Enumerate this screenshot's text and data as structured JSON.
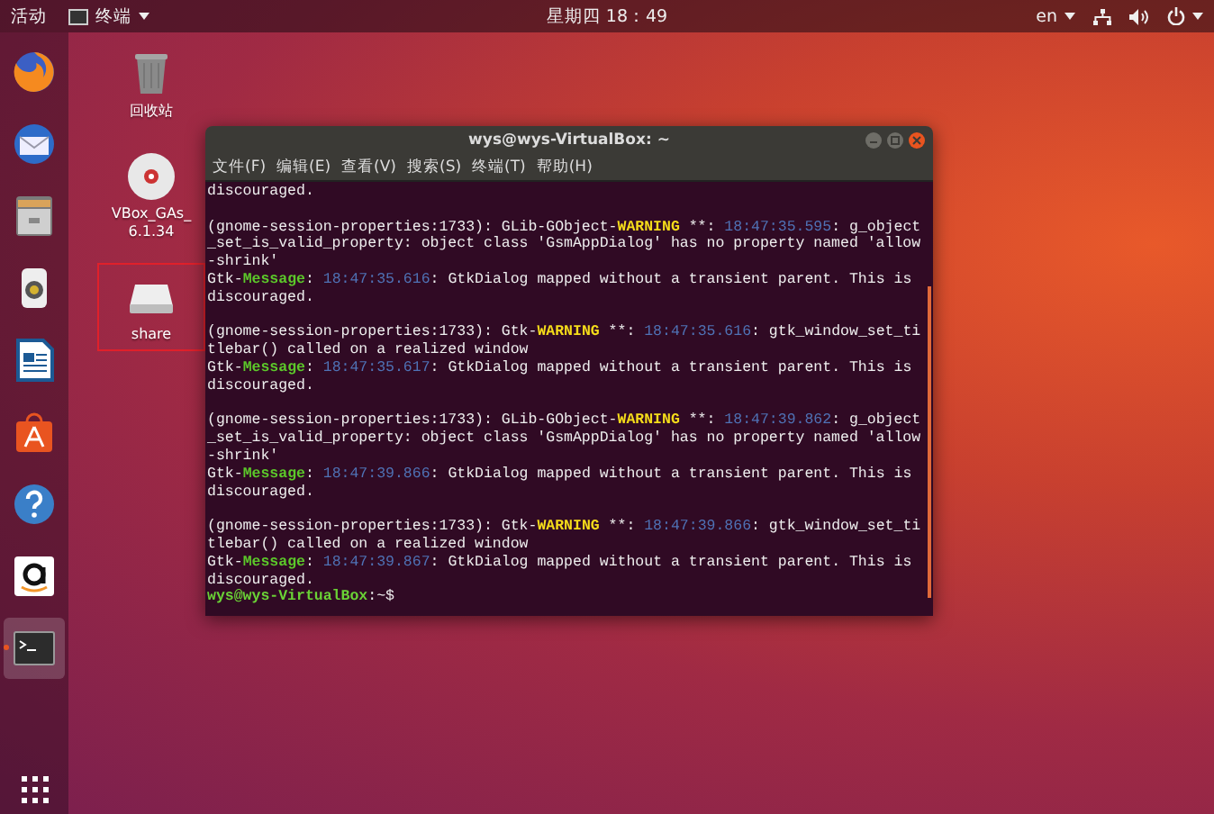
{
  "top_bar": {
    "activities": "活动",
    "app_menu": "终端",
    "clock": "星期四 18：49",
    "input_method": "en"
  },
  "dock": {
    "items": [
      {
        "kind": "firefox",
        "active": false
      },
      {
        "kind": "mail",
        "active": false
      },
      {
        "kind": "files",
        "active": false
      },
      {
        "kind": "music",
        "active": false
      },
      {
        "kind": "writer",
        "active": false
      },
      {
        "kind": "software",
        "active": false
      },
      {
        "kind": "help",
        "active": false
      },
      {
        "kind": "amazon",
        "active": false
      },
      {
        "kind": "terminal",
        "active": true
      }
    ]
  },
  "desktop": {
    "icons": [
      {
        "kind": "trash",
        "label": "回收站",
        "highlighted": false
      },
      {
        "kind": "disc",
        "label": "VBox_GAs_6.1.34",
        "highlighted": false
      },
      {
        "kind": "drive",
        "label": "share",
        "highlighted": true
      }
    ]
  },
  "terminal": {
    "title": "wys@wys-VirtualBox: ~",
    "menu": [
      "文件(F)",
      "编辑(E)",
      "查看(V)",
      "搜索(S)",
      "终端(T)",
      "帮助(H)"
    ],
    "lines": [
      {
        "kind": "text",
        "segments": [
          {
            "kind": "plain",
            "text": "discouraged."
          }
        ]
      },
      {
        "kind": "blank"
      },
      {
        "kind": "text",
        "segments": [
          {
            "kind": "plain",
            "text": "(gnome-session-properties:1733): GLib-GObject-"
          },
          {
            "kind": "warning",
            "text": "WARNING"
          },
          {
            "kind": "plain",
            "text": " **: "
          },
          {
            "kind": "time",
            "text": "18:47:35.595"
          },
          {
            "kind": "plain",
            "text": ": g_object"
          }
        ]
      },
      {
        "kind": "text",
        "segments": [
          {
            "kind": "plain",
            "text": "_set_is_valid_property: object class 'GsmAppDialog' has no property named 'allow"
          }
        ]
      },
      {
        "kind": "text",
        "segments": [
          {
            "kind": "plain",
            "text": "-shrink'"
          }
        ]
      },
      {
        "kind": "text",
        "segments": [
          {
            "kind": "plain",
            "text": "Gtk-"
          },
          {
            "kind": "message",
            "text": "Message"
          },
          {
            "kind": "plain",
            "text": ": "
          },
          {
            "kind": "time",
            "text": "18:47:35.616"
          },
          {
            "kind": "plain",
            "text": ": GtkDialog mapped without a transient parent. This is"
          }
        ]
      },
      {
        "kind": "text",
        "segments": [
          {
            "kind": "plain",
            "text": "discouraged."
          }
        ]
      },
      {
        "kind": "blank"
      },
      {
        "kind": "text",
        "segments": [
          {
            "kind": "plain",
            "text": "(gnome-session-properties:1733): Gtk-"
          },
          {
            "kind": "warning",
            "text": "WARNING"
          },
          {
            "kind": "plain",
            "text": " **: "
          },
          {
            "kind": "time",
            "text": "18:47:35.616"
          },
          {
            "kind": "plain",
            "text": ": gtk_window_set_ti"
          }
        ]
      },
      {
        "kind": "text",
        "segments": [
          {
            "kind": "plain",
            "text": "tlebar() called on a realized window"
          }
        ]
      },
      {
        "kind": "text",
        "segments": [
          {
            "kind": "plain",
            "text": "Gtk-"
          },
          {
            "kind": "message",
            "text": "Message"
          },
          {
            "kind": "plain",
            "text": ": "
          },
          {
            "kind": "time",
            "text": "18:47:35.617"
          },
          {
            "kind": "plain",
            "text": ": GtkDialog mapped without a transient parent. This is"
          }
        ]
      },
      {
        "kind": "text",
        "segments": [
          {
            "kind": "plain",
            "text": "discouraged."
          }
        ]
      },
      {
        "kind": "blank"
      },
      {
        "kind": "text",
        "segments": [
          {
            "kind": "plain",
            "text": "(gnome-session-properties:1733): GLib-GObject-"
          },
          {
            "kind": "warning",
            "text": "WARNING"
          },
          {
            "kind": "plain",
            "text": " **: "
          },
          {
            "kind": "time",
            "text": "18:47:39.862"
          },
          {
            "kind": "plain",
            "text": ": g_object"
          }
        ]
      },
      {
        "kind": "text",
        "segments": [
          {
            "kind": "plain",
            "text": "_set_is_valid_property: object class 'GsmAppDialog' has no property named 'allow"
          }
        ]
      },
      {
        "kind": "text",
        "segments": [
          {
            "kind": "plain",
            "text": "-shrink'"
          }
        ]
      },
      {
        "kind": "text",
        "segments": [
          {
            "kind": "plain",
            "text": "Gtk-"
          },
          {
            "kind": "message",
            "text": "Message"
          },
          {
            "kind": "plain",
            "text": ": "
          },
          {
            "kind": "time",
            "text": "18:47:39.866"
          },
          {
            "kind": "plain",
            "text": ": GtkDialog mapped without a transient parent. This is"
          }
        ]
      },
      {
        "kind": "text",
        "segments": [
          {
            "kind": "plain",
            "text": "discouraged."
          }
        ]
      },
      {
        "kind": "blank"
      },
      {
        "kind": "text",
        "segments": [
          {
            "kind": "plain",
            "text": "(gnome-session-properties:1733): Gtk-"
          },
          {
            "kind": "warning",
            "text": "WARNING"
          },
          {
            "kind": "plain",
            "text": " **: "
          },
          {
            "kind": "time",
            "text": "18:47:39.866"
          },
          {
            "kind": "plain",
            "text": ": gtk_window_set_ti"
          }
        ]
      },
      {
        "kind": "text",
        "segments": [
          {
            "kind": "plain",
            "text": "tlebar() called on a realized window"
          }
        ]
      },
      {
        "kind": "text",
        "segments": [
          {
            "kind": "plain",
            "text": "Gtk-"
          },
          {
            "kind": "message",
            "text": "Message"
          },
          {
            "kind": "plain",
            "text": ": "
          },
          {
            "kind": "time",
            "text": "18:47:39.867"
          },
          {
            "kind": "plain",
            "text": ": GtkDialog mapped without a transient parent. This is"
          }
        ]
      },
      {
        "kind": "text",
        "segments": [
          {
            "kind": "plain",
            "text": "discouraged."
          }
        ]
      },
      {
        "kind": "text",
        "segments": [
          {
            "kind": "prompt",
            "text": "wys@wys-VirtualBox"
          },
          {
            "kind": "plain",
            "text": ":~$"
          }
        ]
      }
    ]
  }
}
